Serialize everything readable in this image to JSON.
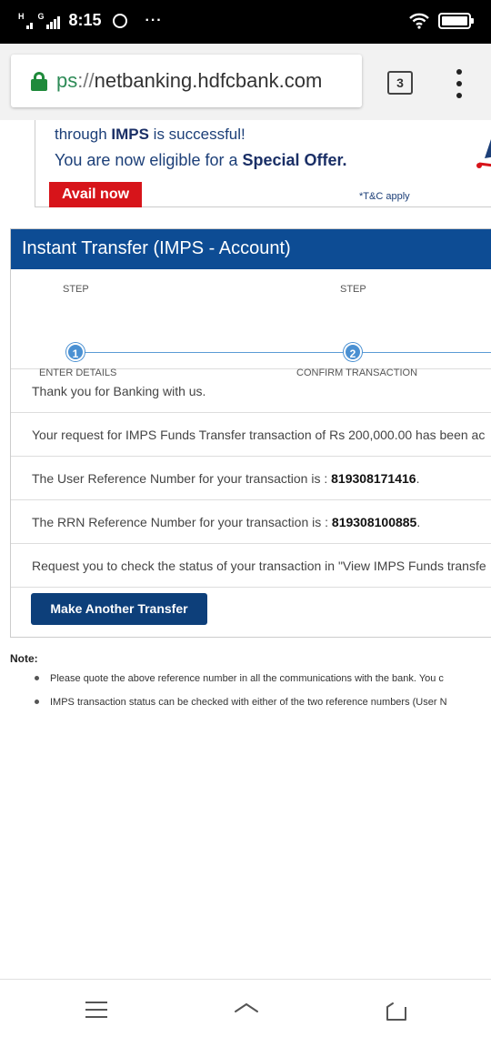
{
  "status_bar": {
    "time": "8:15",
    "signal_label": "H",
    "signal2_label": "G",
    "overflow": "···"
  },
  "browser": {
    "url_scheme": "ps",
    "url_sep": "://",
    "url_host": "netbanking.hdfcbank.com",
    "tab_count": "3"
  },
  "promo": {
    "line1_pre": "through ",
    "line1_bold": "IMPS",
    "line1_post": " is successful!",
    "line2_pre": "You are now eligible for a ",
    "line2_bold": "Special Offer.",
    "cta": "Avail now",
    "tnc": "*T&C apply"
  },
  "card": {
    "title": "Instant Transfer (IMPS - Account)",
    "steps": [
      {
        "label": "STEP",
        "number": "1",
        "caption": "ENTER DETAILS"
      },
      {
        "label": "STEP",
        "number": "2",
        "caption": "CONFIRM TRANSACTION"
      }
    ],
    "messages": {
      "thanks": "Thank you for Banking with us.",
      "request": "Your request for IMPS Funds Transfer transaction of Rs 200,000.00 has been ac",
      "user_ref_pre": "The User Reference Number for your transaction is : ",
      "user_ref": "819308171416",
      "user_ref_post": ".",
      "rrn_pre": "The RRN Reference Number for your transaction is : ",
      "rrn": "819308100885",
      "rrn_post": ".",
      "check": "Request you to check the status of your transaction in \"View IMPS Funds transfe"
    },
    "button": "Make Another Transfer"
  },
  "notes": {
    "title": "Note:",
    "items": [
      "Please quote the above reference number in all the communications with the bank. You c",
      "IMPS transaction status can be checked with either of the two reference numbers (User N"
    ]
  },
  "colors": {
    "header_blue": "#0d4c94",
    "button_blue": "#0d3f7a",
    "cta_red": "#d7141a",
    "lock_green": "#1f8a3b"
  },
  "icons": {
    "lock": "lock-icon",
    "tabs": "tab-switcher-icon",
    "menu": "more-vert-icon",
    "wifi": "wifi-icon",
    "battery": "battery-icon",
    "whatsapp": "whatsapp-icon",
    "nav_home": "menu-lines-icon",
    "nav_back": "back-icon",
    "nav_recent": "recents-icon"
  }
}
